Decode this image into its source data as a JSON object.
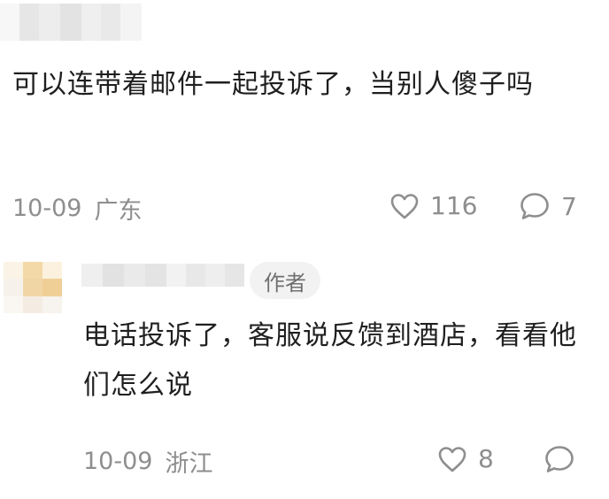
{
  "comments": [
    {
      "text": "可以连带着邮件一起投诉了，当别人傻子吗",
      "date": "10-09",
      "location": "广东",
      "likes": "116",
      "replies": "7"
    },
    {
      "author_badge": "作者",
      "text": "电话投诉了，客服说反馈到酒店，看看他们怎么说",
      "date": "10-09",
      "location": "浙江",
      "likes": "8"
    }
  ],
  "icons": {
    "like": "heart-outline-icon",
    "reply": "speech-bubble-icon"
  },
  "colors": {
    "text": "#1f1f1f",
    "meta": "#8e8e8e",
    "badge_bg": "#f2f2f2",
    "badge_text": "#707070",
    "avatar_tint": "#f1d9a8"
  }
}
